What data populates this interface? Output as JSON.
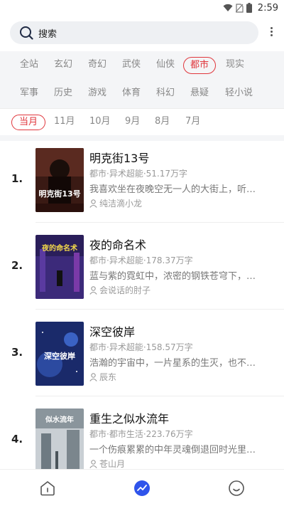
{
  "status_bar": {
    "time": "2:59",
    "icons": [
      "wifi-icon",
      "no-sim-icon",
      "battery-icon"
    ]
  },
  "search": {
    "label": "搜索",
    "icon": "search-icon",
    "more_icon": "more-vertical-icon"
  },
  "categories": {
    "row1": [
      "全站",
      "玄幻",
      "奇幻",
      "武侠",
      "仙侠",
      "都市",
      "现实"
    ],
    "row2": [
      "军事",
      "历史",
      "游戏",
      "体育",
      "科幻",
      "悬疑",
      "轻小说"
    ],
    "active": "都市"
  },
  "months": {
    "items": [
      "当月",
      "11月",
      "10月",
      "9月",
      "8月",
      "7月"
    ],
    "active": "当月"
  },
  "books": [
    {
      "rank": "1.",
      "title": "明克街13号",
      "meta": "都市·异术超能·51.17万字",
      "desc": "我喜欢坐在夜晚空无一人的大街上，听…",
      "author": "纯洁滴小龙",
      "cover_text": "明克街13号"
    },
    {
      "rank": "2.",
      "title": "夜的命名术",
      "meta": "都市·异术超能·178.37万字",
      "desc": "蓝与紫的霓虹中，浓密的钢铁苍穹下，…",
      "author": "会说话的肘子",
      "cover_text": "夜的命名术"
    },
    {
      "rank": "3.",
      "title": "深空彼岸",
      "meta": "都市·异术超能·158.57万字",
      "desc": "浩瀚的宇宙中，一片星系的生灭，也不…",
      "author": "辰东",
      "cover_text": "深空彼岸"
    },
    {
      "rank": "4.",
      "title": "重生之似水流年",
      "meta": "都市·都市生活·223.76万字",
      "desc": "一个伤痕累累的中年灵魂倒退回时光里…",
      "author": "苍山月",
      "cover_text": "似水流年"
    }
  ],
  "bottom_nav": {
    "items": [
      "home-icon",
      "trending-icon",
      "smiley-icon"
    ],
    "active": "trending-icon",
    "accent": "#2f54eb"
  },
  "colors": {
    "accent_red": "#e0363c"
  }
}
